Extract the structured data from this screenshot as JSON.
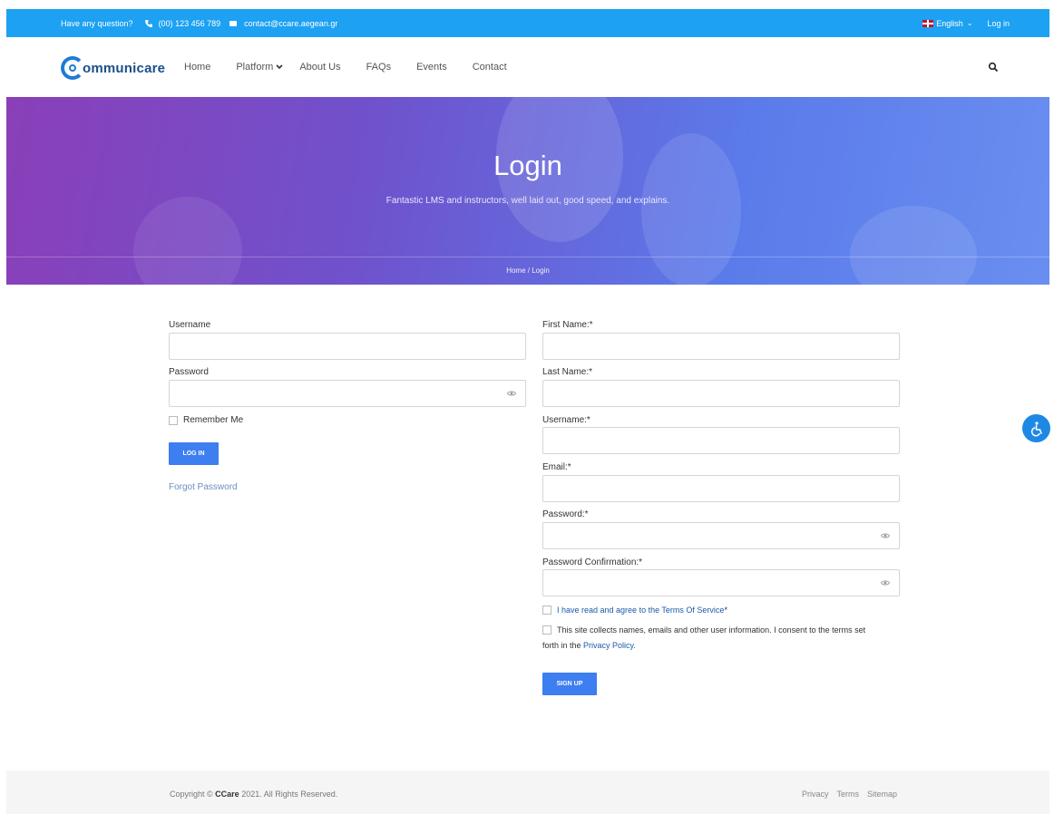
{
  "topbar": {
    "question": "Have any question?",
    "phone": "(00) 123 456 789",
    "email": "contact@ccare.aegean.gr",
    "language": "English",
    "login": "Log in"
  },
  "nav": {
    "logo_text": "ommunicare",
    "items": [
      "Home",
      "Platform",
      "About Us",
      "FAQs",
      "Events",
      "Contact"
    ]
  },
  "hero": {
    "title": "Login",
    "subtitle": "Fantastic LMS and instructors, well laid out, good speed, and explains.",
    "breadcrumb": "Home / Login"
  },
  "login_form": {
    "username_label": "Username",
    "username_value": "",
    "password_label": "Password",
    "password_value": "",
    "remember_label": "Remember Me",
    "login_button": "LOG IN",
    "forgot_link": "Forgot Password"
  },
  "register_form": {
    "first_name_label": "First Name:*",
    "last_name_label": "Last Name:*",
    "username_label": "Username:*",
    "email_label": "Email:*",
    "password_label": "Password:*",
    "password_confirm_label": "Password Confirmation:*",
    "terms_text": "I have read and agree to the Terms Of Service",
    "terms_asterisk": "*",
    "privacy_text_1": "This site collects names, emails and other user information. I consent to the terms set",
    "privacy_text_2": "forth in the",
    "privacy_link": "Privacy Policy.",
    "signup_button": "SIGN UP"
  },
  "footer": {
    "copyright_prefix": "Copyright ©",
    "copyright_brand": "CCare",
    "copyright_suffix": "2021. All Rights Reserved.",
    "links": [
      "Privacy",
      "Terms",
      "Sitemap"
    ]
  },
  "colors": {
    "topbar": "#1da1f2",
    "button": "#3d7ef0",
    "link": "#1a5aa8",
    "hero_start": "#8a3fb8",
    "hero_end": "#6a8ef0"
  }
}
